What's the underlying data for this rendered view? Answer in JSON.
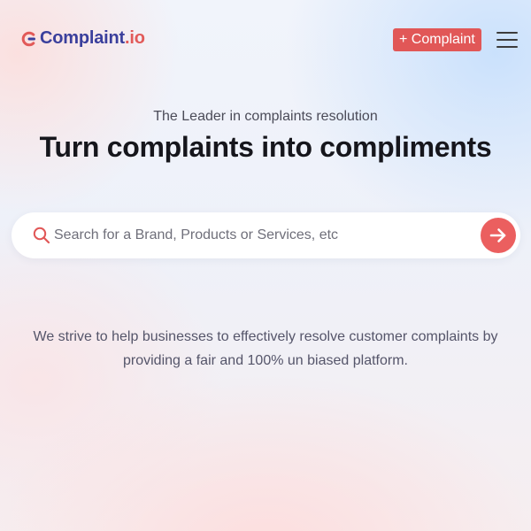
{
  "header": {
    "logo": {
      "name": "Complaint",
      "suffix": ".io",
      "icon": "logo-c-icon"
    },
    "add_complaint_label": "+ Complaint",
    "menu_icon": "hamburger-menu-icon"
  },
  "hero": {
    "tagline": "The Leader in complaints resolution",
    "headline": "Turn complaints into compliments"
  },
  "search": {
    "placeholder": "Search for a Brand, Products or Services, etc",
    "value": "",
    "icon": "search-icon",
    "submit_icon": "arrow-right-icon"
  },
  "description": {
    "line1": "We strive to help businesses to effectively resolve customer complaints by",
    "line2": "providing a fair and 100% un biased platform."
  },
  "colors": {
    "brand_primary": "#3a3f9c",
    "brand_accent": "#e15757",
    "headline": "#16161c"
  }
}
